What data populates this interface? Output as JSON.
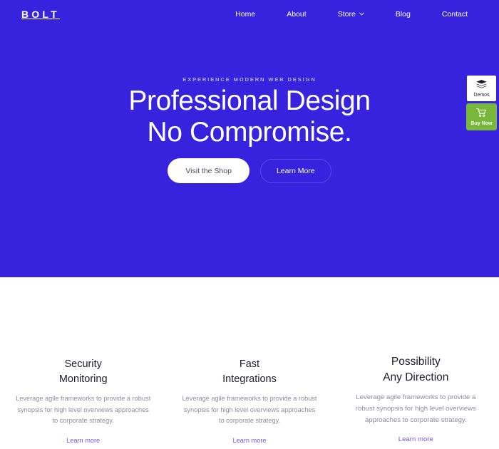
{
  "colors": {
    "hero_background": "#3722dd",
    "page_background": "#ffffff",
    "accent_link": "#6b5ce7",
    "buy_now_green": "#77b73a",
    "eyebrow_text": "#b6abef",
    "card_title": "#1c1c2b",
    "card_body": "#8d8d9c"
  },
  "navbar": {
    "logo": "BOLT",
    "links": [
      {
        "label": "Home",
        "has_dropdown": false
      },
      {
        "label": "About",
        "has_dropdown": false
      },
      {
        "label": "Store",
        "has_dropdown": true,
        "dropdown_icon": "chevron-down-icon"
      },
      {
        "label": "Blog",
        "has_dropdown": false
      },
      {
        "label": "Contact",
        "has_dropdown": false
      }
    ]
  },
  "hero": {
    "eyebrow": "EXPERIENCE MODERN WEB DESIGN",
    "headline_line1": "Professional Design",
    "headline_line2": "No Compromise.",
    "primary_button": "Visit the Shop",
    "secondary_button": "Learn More"
  },
  "side_widgets": [
    {
      "label": "Demos",
      "icon": "layers-icon"
    },
    {
      "label": "Buy Now",
      "icon": "shopping-cart-icon"
    }
  ],
  "features": {
    "cards": [
      {
        "title": "Security\nMonitoring",
        "body": "Leverage agile frameworks to provide a robust synopsis for high level overviews approaches to corporate strategy.",
        "link": "Learn more"
      },
      {
        "title": "Fast\nIntegrations",
        "body": "Leverage agile frameworks to provide a robust synopsis for high level overviews approaches to corporate strategy.",
        "link": "Learn more"
      },
      {
        "title": "Possibility\nAny Direction",
        "body": "Leverage agile frameworks to provide a robust synopsis for high level overviews approaches to corporate strategy.",
        "link": "Learn more"
      }
    ]
  }
}
